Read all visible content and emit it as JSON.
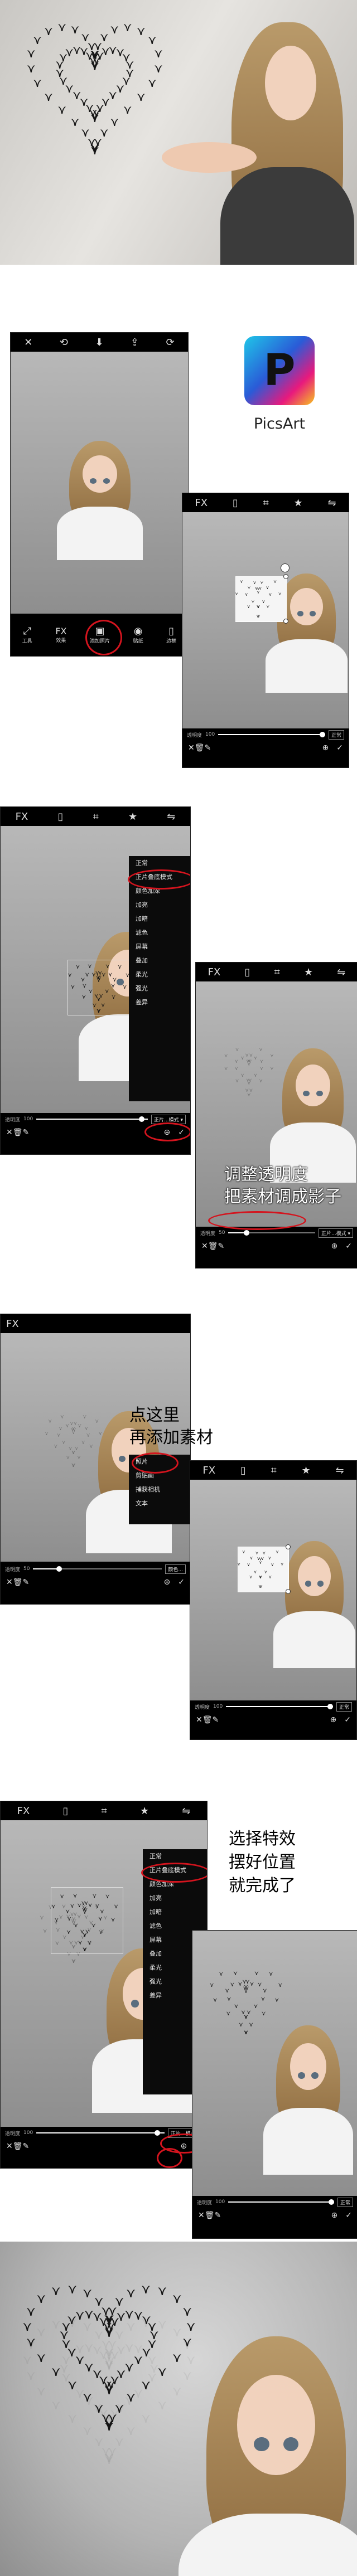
{
  "app": {
    "name": "PicsArt",
    "logo_letter": "P"
  },
  "toolbar": {
    "fx_label": "FX",
    "close_glyph": "✕",
    "undo_glyph": "⟲",
    "download_glyph": "⬇",
    "share_glyph": "⇪",
    "redo_glyph": "⟳"
  },
  "step1": {
    "tools": [
      "工具",
      "效果",
      "添加照片",
      "贴纸",
      "边框"
    ]
  },
  "slider": {
    "label": "透明度",
    "value_full": "100",
    "value_mid": "50",
    "blend_normal": "正常",
    "blend_multiply": "正片叠底模式 ▾",
    "blend_short": "正片...模式 ▾",
    "blend_color": "颜色..."
  },
  "blend_menu": {
    "items": [
      "正常",
      "正片叠底模式",
      "颜色加深",
      "加亮",
      "加暗",
      "滤色",
      "屏幕",
      "叠加",
      "柔光",
      "强光",
      "差异"
    ]
  },
  "add_menu": {
    "items": [
      "照片",
      "剪贴画",
      "捕获相机",
      "文本"
    ]
  },
  "annotations": {
    "step2_line1": "调整透明度",
    "step2_line2": "把素材调成影子",
    "step3_line1": "点这里",
    "step3_line2": "再添加素材",
    "step4_line1": "选择特效",
    "step4_line2": "摆好位置",
    "step4_line3": "就完成了"
  },
  "colors": {
    "highlight_red": "#d4141e",
    "logo_cyan": "#1fc6e8",
    "logo_blue": "#2a5bd7",
    "logo_pink": "#e8197d",
    "logo_yellow": "#f7c51e"
  }
}
